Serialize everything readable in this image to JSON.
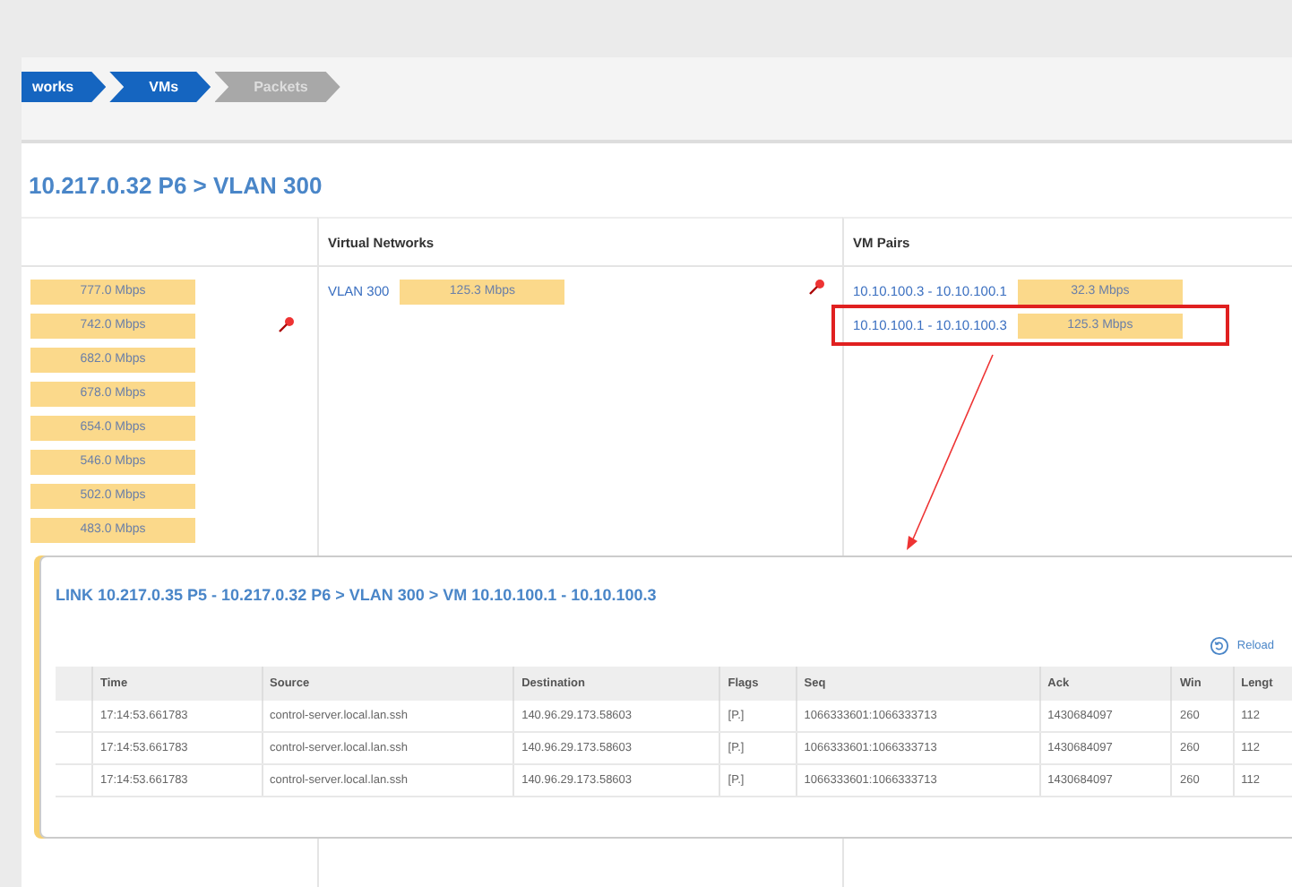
{
  "breadcrumb": [
    {
      "label": "works",
      "disabled": false
    },
    {
      "label": "VMs",
      "disabled": false
    },
    {
      "label": "Packets",
      "disabled": true
    }
  ],
  "title": "10.217.0.32 P6 > VLAN 300",
  "columns": [
    "Virtual Networks",
    "VM Pairs"
  ],
  "links": [
    {
      "value": "777.0 Mbps",
      "pinned": false
    },
    {
      "value": "742.0 Mbps",
      "pinned": true
    },
    {
      "value": "682.0 Mbps",
      "pinned": false
    },
    {
      "value": "678.0 Mbps",
      "pinned": false
    },
    {
      "value": "654.0 Mbps",
      "pinned": false
    },
    {
      "value": "546.0 Mbps",
      "pinned": false
    },
    {
      "value": "502.0 Mbps",
      "pinned": false
    },
    {
      "value": "483.0 Mbps",
      "pinned": false
    }
  ],
  "networks": [
    {
      "name": "VLAN 300",
      "value": "125.3 Mbps",
      "pinned": true
    }
  ],
  "pairs": [
    {
      "name": "10.10.100.3 - 10.10.100.1",
      "value": "32.3 Mbps",
      "highlighted": false
    },
    {
      "name": "10.10.100.1 - 10.10.100.3",
      "value": "125.3 Mbps",
      "highlighted": true
    }
  ],
  "popup": {
    "title": "LINK 10.217.0.35 P5 - 10.217.0.32 P6 > VLAN 300 > VM 10.10.100.1 - 10.10.100.3",
    "reload": "Reload",
    "columns": [
      "Time",
      "Source",
      "Destination",
      "Flags",
      "Seq",
      "Ack",
      "Win",
      "Lengt"
    ],
    "rows": [
      [
        "17:14:53.661783",
        "control-server.local.lan.ssh",
        "140.96.29.173.58603",
        "[P.]",
        "1066333601:1066333713",
        "1430684097",
        "260",
        "112"
      ],
      [
        "17:14:53.661783",
        "control-server.local.lan.ssh",
        "140.96.29.173.58603",
        "[P.]",
        "1066333601:1066333713",
        "1430684097",
        "260",
        "112"
      ],
      [
        "17:14:53.661783",
        "control-server.local.lan.ssh",
        "140.96.29.173.58603",
        "[P.]",
        "1066333601:1066333713",
        "1430684097",
        "260",
        "112"
      ]
    ]
  }
}
